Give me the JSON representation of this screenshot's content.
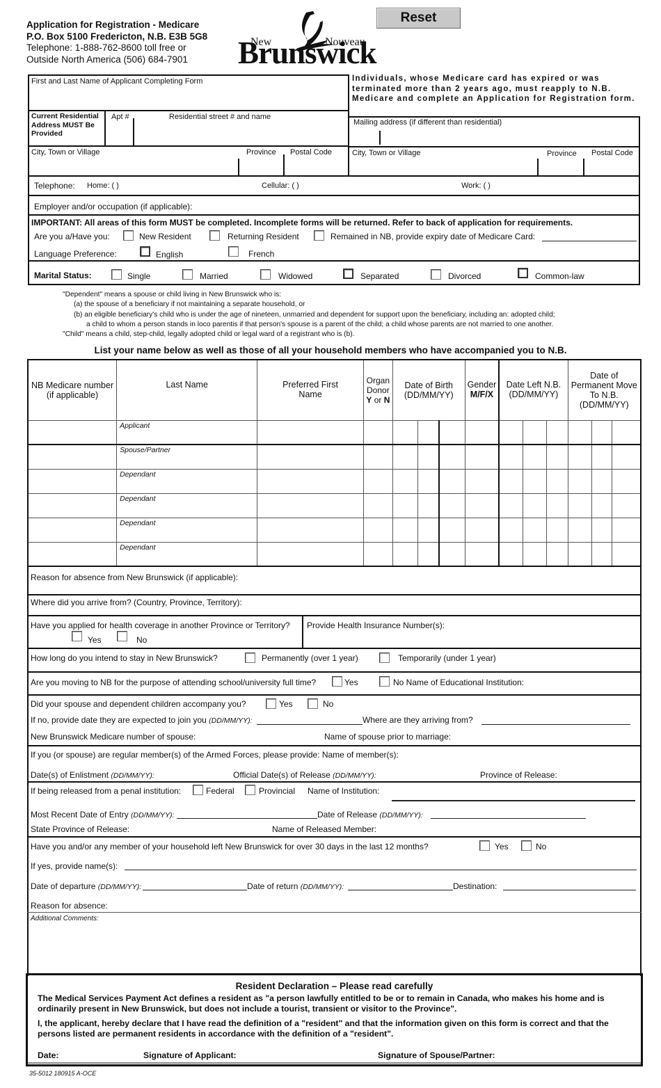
{
  "header": {
    "line1": "Application for Registration -  Medicare",
    "line2": "P.O. Box 5100 Fredericton, N.B.  E3B 5G8",
    "line3": "Telephone:  1-888-762-8600 toll free or",
    "line4": "Outside North America (506) 684-7901"
  },
  "logo": {
    "new": "New",
    "nouveau": "Nouveau",
    "brunswick": "Brunswick",
    "icon": "ship-icon"
  },
  "reset_label": "Reset",
  "notice": "Individuals, whose Medicare card has expired or was terminated more than 2 years ago, must reapply to N.B. Medicare and complete an Application for Registration form.",
  "applicant": {
    "name_label": "First and Last Name of Applicant Completing Form",
    "residential_label": "Current Residential Address MUST Be Provided",
    "apt_label": "Apt #",
    "street_label": "Residential street # and name",
    "mailing_label": "Mailing address (if different than residential)",
    "city_label": "City, Town or Village",
    "province_label": "Province",
    "postal_label": "Postal Code",
    "telephone_label": "Telephone:",
    "home_label": "Home:  (            )",
    "cellular_label": "Cellular:  (            )",
    "work_label": "Work:  (            )",
    "employer_label": "Employer and/or occupation (if applicable):"
  },
  "important": {
    "text": "IMPORTANT:  All areas of this form MUST be completed.  Incomplete forms will be returned.  Refer to back of application for requirements.",
    "are_you_label": "Are you a/Have you:",
    "options": [
      "New Resident",
      "Returning Resident",
      "Remained in NB, provide expiry date of Medicare Card:"
    ],
    "language_label": "Language Preference:",
    "languages": [
      "English",
      "French"
    ]
  },
  "marital": {
    "label": "Marital Status:",
    "options": [
      "Single",
      "Married",
      "Widowed",
      "Separated",
      "Divorced",
      "Common-law"
    ]
  },
  "definitions": {
    "line1": "\"Dependent\" means a spouse or child living in New Brunswick who is:",
    "line2": "(a)  the spouse of a beneficiary if not maintaining a separate household, or",
    "line3": "(b)  an eligible beneficiary's child who is under the age of nineteen, unmarried and dependent for support upon the beneficiary, including an:  adopted child;",
    "line4": "a child to whom a person stands in loco parentis if that person's spouse is a parent of the child; a child whose parents are not married to one another.",
    "line5": "\"Child\" means a child, step-child, legally adopted child or legal ward of a registrant who is (b)."
  },
  "members": {
    "heading": "List your name below as well as those of all your household members who have accompanied you to N.B.",
    "columns": {
      "medicare": "NB Medicare number (if applicable)",
      "last_name": "Last Name",
      "first_name": "Preferred First Name",
      "organ_donor": "Organ Donor",
      "organ_yn_y": "Y",
      "organ_yn_or": " or ",
      "organ_yn_n": "N",
      "dob": "Date of Birth (DD/MM/YY)",
      "gender": "Gender",
      "gender_opts": "M/F/X",
      "date_left": "Date Left N.B. (DD/MM/YY)",
      "date_move": "Date of Permanent Move To N.B. (DD/MM/YY)"
    },
    "rows": [
      "Applicant",
      "Spouse/Partner",
      "Dependant",
      "Dependant",
      "Dependant",
      "Dependant"
    ]
  },
  "questions": {
    "reason_absence": "Reason for absence from New Brunswick (if applicable):",
    "arrive_from": "Where did you arrive from? (Country, Province, Territory):",
    "applied_coverage": "Have you applied for health coverage in another Province or Territory?",
    "yes": "Yes",
    "no": "No",
    "health_number": "Provide Health Insurance Number(s):",
    "stay_length": "How long do you intend to stay in New Brunswick?",
    "permanently": "Permanently (over 1 year)",
    "temporarily": "Temporarily (under 1 year)",
    "school": "Are you moving to NB for the purpose of attending school/university full time?",
    "school_no_inst": "No  Name of Educational Institution:",
    "spouse_accompany": "Did your spouse and dependent children accompany you?",
    "if_no_date": "If no, provide date they are expected to join you ",
    "ddmmyy": "(DD/MM/YY):",
    "arriving_from": "Where are they arriving from?",
    "spouse_medicare": "New Brunswick Medicare number of spouse:",
    "spouse_name_prior": "Name of spouse prior to marriage:",
    "armed_forces": "If you (or spouse) are regular member(s) of the Armed Forces, please provide:  Name of member(s):",
    "enlistment": "Date(s) of Enlistment ",
    "official_release": "Official Date(s) of Release ",
    "province_release": "Province of Release:",
    "penal": "If being released from a penal institution:",
    "federal": "Federal",
    "provincial": "Provincial",
    "institution_name": "Name of Institution:",
    "recent_entry": "Most Recent Date of Entry ",
    "date_release": "Date of Release ",
    "state_province_release": "State Province of Release:",
    "released_member": "Name of Released Member:",
    "left_nb": "Have you and/or any member of your household left New Brunswick for over 30 days in the last 12 months?",
    "if_yes_names": "If yes, provide name(s):",
    "departure": "Date of departure ",
    "return": "Date of return ",
    "destination": "Destination:",
    "reason": "Reason for absence:",
    "comments": "Additional Comments:"
  },
  "declaration": {
    "title": "Resident Declaration – Please read carefully",
    "p1": "The Medical Services Payment Act defines a resident as \"a person lawfully entitled to be or to remain in Canada, who makes his home and is ordinarily present in New Brunswick, but does not include a tourist, transient or visitor to the Province\".",
    "p2": "I, the applicant, hereby declare that I have read the definition of a \"resident\" and that the information given on this form is correct and that the persons listed are permanent residents in accordance with the definition of a \"resident\".",
    "date": "Date:",
    "sig_applicant": "Signature of Applicant:",
    "sig_spouse": "Signature of Spouse/Partner:"
  },
  "footer": "35-5012   180915 A-OCE"
}
